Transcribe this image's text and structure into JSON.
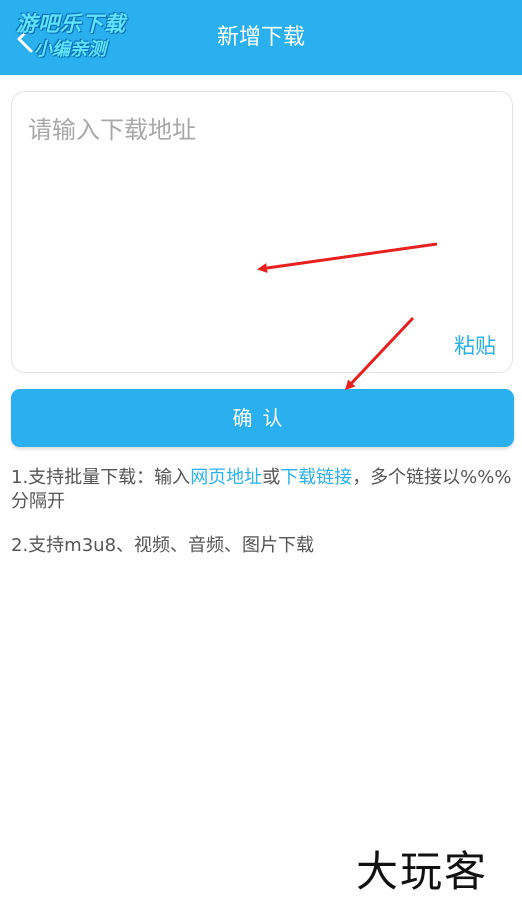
{
  "header": {
    "title": "新增下载",
    "back_icon": "back-arrow-icon",
    "background": "#2ab0ee"
  },
  "watermark": {
    "line1": "游吧乐下载",
    "line2": "小编亲测"
  },
  "input": {
    "placeholder": "请输入下载地址",
    "value": ""
  },
  "paste_label": "粘贴",
  "confirm_label": "确认",
  "tips": {
    "tip1_prefix": "1.支持批量下载：输入",
    "tip1_link1": "网页地址",
    "tip1_mid": "或",
    "tip1_link2": "下载链接",
    "tip1_suffix": "，多个链接以%%%分隔开",
    "tip2": "2.支持m3u8、视频、音频、图片下载"
  },
  "bottom_logo": "大玩客",
  "accent_color": "#2ab0ee",
  "annotation_arrow_color": "#e8201e"
}
